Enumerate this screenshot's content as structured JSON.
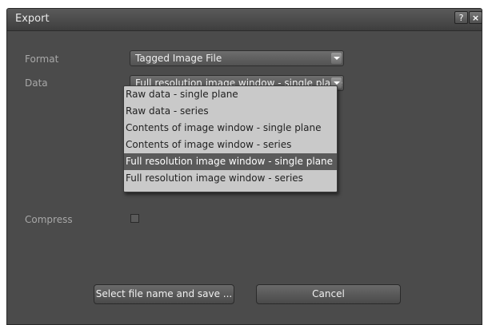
{
  "window": {
    "title": "Export",
    "help_label": "?",
    "close_label": "×"
  },
  "form": {
    "format_label": "Format",
    "format_value": "Tagged Image File",
    "data_label": "Data",
    "data_value": "Full resolution image window - single plane",
    "data_options": [
      "Raw data - single plane",
      "Raw data - series",
      "Contents of image window - single plane",
      "Contents of image window - series",
      "Full resolution image window - single plane",
      "Full resolution image window - series"
    ],
    "data_selected_index": 4,
    "compress_label": "Compress",
    "compress_checked": false
  },
  "buttons": {
    "save_label": "Select file name and save ...",
    "cancel_label": "Cancel"
  }
}
